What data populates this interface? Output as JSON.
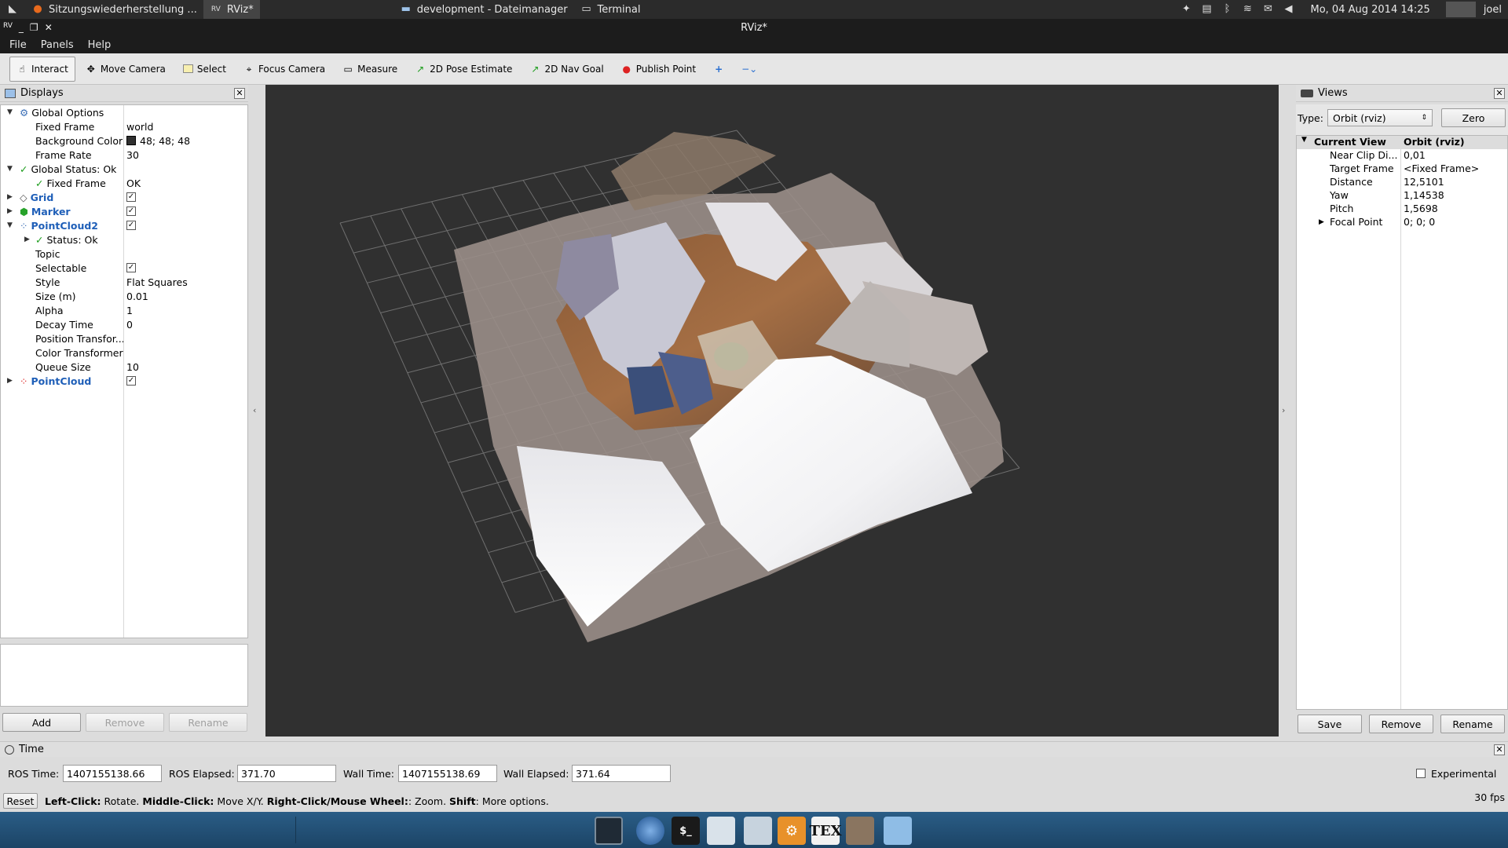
{
  "system_bar": {
    "tasks": [
      "Sitzungswiederherstellung ...",
      "RViz*",
      "development - Dateimanager",
      "Terminal"
    ],
    "clock": "Mo, 04 Aug 2014 14:25",
    "user": "joel"
  },
  "window": {
    "title": "RViz*"
  },
  "menu": {
    "file": "File",
    "panels": "Panels",
    "help": "Help"
  },
  "toolbar": {
    "interact": "Interact",
    "move_camera": "Move Camera",
    "select": "Select",
    "focus_camera": "Focus Camera",
    "measure": "Measure",
    "pose_estimate": "2D Pose Estimate",
    "nav_goal": "2D Nav Goal",
    "publish_point": "Publish Point"
  },
  "displays": {
    "title": "Displays",
    "rows": [
      {
        "name": "Global Options",
        "value": ""
      },
      {
        "name": "Fixed Frame",
        "value": "world"
      },
      {
        "name": "Background Color",
        "value": "48; 48; 48"
      },
      {
        "name": "Frame Rate",
        "value": "30"
      },
      {
        "name": "Global Status: Ok",
        "value": ""
      },
      {
        "name": "Fixed Frame",
        "value": "OK"
      },
      {
        "name": "Grid",
        "value": ""
      },
      {
        "name": "Marker",
        "value": ""
      },
      {
        "name": "PointCloud2",
        "value": ""
      },
      {
        "name": "Status: Ok",
        "value": ""
      },
      {
        "name": "Topic",
        "value": ""
      },
      {
        "name": "Selectable",
        "value": ""
      },
      {
        "name": "Style",
        "value": "Flat Squares"
      },
      {
        "name": "Size (m)",
        "value": "0.01"
      },
      {
        "name": "Alpha",
        "value": "1"
      },
      {
        "name": "Decay Time",
        "value": "0"
      },
      {
        "name": "Position Transfor...",
        "value": ""
      },
      {
        "name": "Color Transformer",
        "value": ""
      },
      {
        "name": "Queue Size",
        "value": "10"
      },
      {
        "name": "PointCloud",
        "value": ""
      }
    ],
    "add": "Add",
    "remove": "Remove",
    "rename": "Rename"
  },
  "views": {
    "title": "Views",
    "type_label": "Type:",
    "type_value": "Orbit (rviz)",
    "zero": "Zero",
    "header_key": "Current View",
    "header_value": "Orbit (rviz)",
    "rows": [
      {
        "key": "Near Clip Di...",
        "value": "0,01"
      },
      {
        "key": "Target Frame",
        "value": "<Fixed Frame>"
      },
      {
        "key": "Distance",
        "value": "12,5101"
      },
      {
        "key": "Yaw",
        "value": "1,14538"
      },
      {
        "key": "Pitch",
        "value": "1,5698"
      },
      {
        "key": "Focal Point",
        "value": "0; 0; 0"
      }
    ],
    "save": "Save",
    "remove": "Remove",
    "rename": "Rename"
  },
  "time": {
    "title": "Time",
    "ros_time_label": "ROS Time:",
    "ros_time": "1407155138.66",
    "ros_elapsed_label": "ROS Elapsed:",
    "ros_elapsed": "371.70",
    "wall_time_label": "Wall Time:",
    "wall_time": "1407155138.69",
    "wall_elapsed_label": "Wall Elapsed:",
    "wall_elapsed": "371.64",
    "experimental": "Experimental"
  },
  "status": {
    "reset": "Reset",
    "left_click": "Left-Click:",
    "left_click_text": "Rotate.",
    "middle_click": "Middle-Click:",
    "middle_click_text": "Move X/Y.",
    "right_click": "Right-Click/Mouse Wheel:",
    "right_click_text": ": Zoom.",
    "shift": "Shift",
    "shift_text": ": More options.",
    "fps": "30 fps"
  },
  "colors": {
    "viewport_bg": "#303030",
    "link_blue": "#1f5fb8",
    "ok_green": "#1a9c1a"
  },
  "dock": {
    "tex_label": "TEX"
  }
}
